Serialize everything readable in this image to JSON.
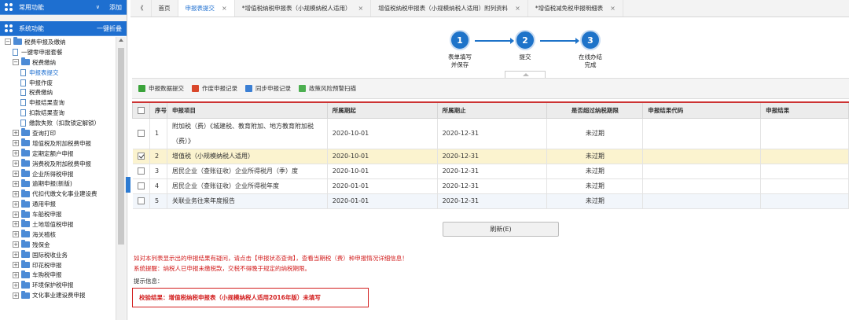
{
  "sidebar": {
    "common_title": "常用功能",
    "common_action": "添加",
    "system_title": "系统功能",
    "system_action": "一键折叠",
    "tree": [
      {
        "label": "税费申报及缴纳",
        "kind": "folder",
        "pm": "−",
        "indent": 0
      },
      {
        "label": "一键零申报套餐",
        "kind": "doc",
        "indent": 1
      },
      {
        "label": "税费缴纳",
        "kind": "folder",
        "pm": "−",
        "indent": 1
      },
      {
        "label": "申报表提交",
        "kind": "doc",
        "indent": 2,
        "selected": true
      },
      {
        "label": "申报作废",
        "kind": "doc",
        "indent": 2
      },
      {
        "label": "税费缴纳",
        "kind": "doc",
        "indent": 2
      },
      {
        "label": "申报结果查询",
        "kind": "doc",
        "indent": 2
      },
      {
        "label": "扣款结果查询",
        "kind": "doc",
        "indent": 2
      },
      {
        "label": "缴款失败（扣款锁定解锁）",
        "kind": "doc",
        "indent": 2
      },
      {
        "label": "查询打印",
        "kind": "folder",
        "pm": "+",
        "indent": 1
      },
      {
        "label": "增值税及附加税费申报",
        "kind": "folder",
        "pm": "+",
        "indent": 1
      },
      {
        "label": "定期定额户申报",
        "kind": "folder",
        "pm": "+",
        "indent": 1
      },
      {
        "label": "消费税及附加税费申报",
        "kind": "folder",
        "pm": "+",
        "indent": 1
      },
      {
        "label": "企业所得税申报",
        "kind": "folder",
        "pm": "+",
        "indent": 1
      },
      {
        "label": "逾期申报(新版)",
        "kind": "folder",
        "pm": "+",
        "indent": 1
      },
      {
        "label": "代扣代缴文化事业建设费",
        "kind": "folder",
        "pm": "+",
        "indent": 1
      },
      {
        "label": "通用申报",
        "kind": "folder",
        "pm": "+",
        "indent": 1
      },
      {
        "label": "车船税申报",
        "kind": "folder",
        "pm": "+",
        "indent": 1
      },
      {
        "label": "土地增值税申报",
        "kind": "folder",
        "pm": "+",
        "indent": 1
      },
      {
        "label": "海关稽核",
        "kind": "folder",
        "pm": "+",
        "indent": 1
      },
      {
        "label": "残保金",
        "kind": "folder",
        "pm": "+",
        "indent": 1
      },
      {
        "label": "国际税收业务",
        "kind": "folder",
        "pm": "+",
        "indent": 1
      },
      {
        "label": "印花税申报",
        "kind": "folder",
        "pm": "+",
        "indent": 1
      },
      {
        "label": "车购税申报",
        "kind": "folder",
        "pm": "+",
        "indent": 1
      },
      {
        "label": "环境保护税申报",
        "kind": "folder",
        "pm": "+",
        "indent": 1
      },
      {
        "label": "文化事业建设费申报",
        "kind": "folder",
        "pm": "+",
        "indent": 1
      }
    ]
  },
  "tabs": [
    {
      "label": "《",
      "close": ""
    },
    {
      "label": "首页",
      "close": ""
    },
    {
      "label": "申报表提交",
      "close": "×",
      "active": true
    },
    {
      "label": "*增值税纳税申报表（小规模纳税人适用）",
      "close": "×"
    },
    {
      "label": "增值税纳税申报表（小规模纳税人适用）附列资料",
      "close": "×"
    },
    {
      "label": "*增值税减免税申报明细表",
      "close": "×"
    }
  ],
  "steps": [
    {
      "num": "1",
      "label": "表单填写\n并保存"
    },
    {
      "num": "2",
      "label": "提交"
    },
    {
      "num": "3",
      "label": "在线办结\n完成"
    }
  ],
  "toolbar": [
    {
      "label": "申报数据提交",
      "icon": "submit-icon",
      "color": "#3aa33a"
    },
    {
      "label": "作废申报记录",
      "icon": "void-icon",
      "color": "#d9472b"
    },
    {
      "label": "同步申报记录",
      "icon": "sync-icon",
      "color": "#3b7fd4"
    },
    {
      "label": "政策风险预警扫描",
      "icon": "scan-icon",
      "color": "#4caf50"
    }
  ],
  "table": {
    "headers": [
      "",
      "序号",
      "申报项目",
      "所属期起",
      "所属期止",
      "是否超过纳税期限",
      "申报结果代码",
      "申报结果"
    ],
    "rows": [
      {
        "checked": false,
        "no": "1",
        "item": "附加税（费）《城建税、教育附加、地方教育附加税（费）》",
        "start": "2020-10-01",
        "end": "2020-12-31",
        "overdue": "未过期",
        "code": "",
        "result": ""
      },
      {
        "checked": true,
        "no": "2",
        "item": "增值税（小规模纳税人适用）",
        "start": "2020-10-01",
        "end": "2020-12-31",
        "overdue": "未过期",
        "code": "",
        "result": ""
      },
      {
        "checked": false,
        "no": "3",
        "item": "居民企业（查账征收）企业所得税月（季）度",
        "start": "2020-10-01",
        "end": "2020-12-31",
        "overdue": "未过期",
        "code": "",
        "result": ""
      },
      {
        "checked": false,
        "no": "4",
        "item": "居民企业（查账征收）企业所得税年度",
        "start": "2020-01-01",
        "end": "2020-12-31",
        "overdue": "未过期",
        "code": "",
        "result": ""
      },
      {
        "checked": false,
        "no": "5",
        "item": "关联业务往来年度报告",
        "start": "2020-01-01",
        "end": "2020-12-31",
        "overdue": "未过期",
        "code": "",
        "result": ""
      }
    ]
  },
  "refresh_label": "刷新(E)",
  "notes": {
    "line1": "如对本列表显示出的申报结果有疑问，请点击【申报状态查询】，查看当期税（费）种申报情况详细信息！",
    "line2": "系统提醒：纳税人已申报未缴税款，交税不得晚于规定的纳税期限。",
    "prompt": "提示信息：",
    "validation": "校验结果：增值税纳税申报表（小规模纳税人适用2016年版）未填写"
  }
}
